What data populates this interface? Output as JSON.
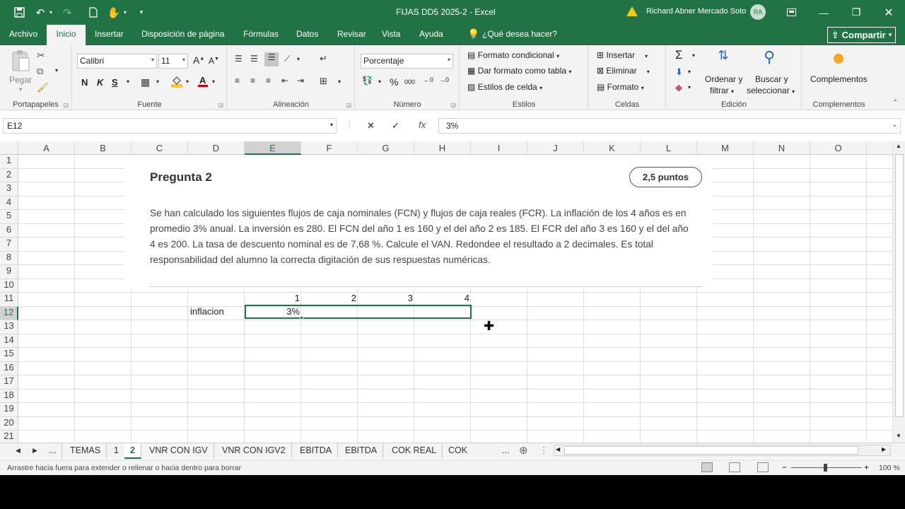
{
  "titlebar": {
    "title": "FIJAS DD5 2025-2  -  Excel",
    "user": "Richard Abner Mercado Soto",
    "avatar": "RA",
    "icons": [
      "save-icon",
      "undo-icon",
      "redo-icon",
      "new-file-icon",
      "touch-mode-icon",
      "customize-qat-icon",
      "warning-icon",
      "ribbon-display-icon",
      "minimize-icon",
      "restore-icon",
      "close-icon"
    ]
  },
  "tabs": [
    "Archivo",
    "Inicio",
    "Insertar",
    "Disposición de página",
    "Fórmulas",
    "Datos",
    "Revisar",
    "Vista",
    "Ayuda",
    "¿Qué desea hacer?"
  ],
  "share_label": "Compartir",
  "ribbon": {
    "clipboard": {
      "label": "Portapapeles",
      "paste": "Pegar"
    },
    "font": {
      "label": "Fuente",
      "font_name": "Calibri",
      "font_size": "11",
      "bold": "N",
      "italic": "K",
      "underline": "S"
    },
    "alignment": {
      "label": "Alineación"
    },
    "number": {
      "label": "Número",
      "format": "Porcentaje"
    },
    "styles": {
      "label": "Estilos",
      "conditional": "Formato condicional",
      "as_table": "Dar formato como tabla",
      "cell_styles": "Estilos de celda"
    },
    "cells": {
      "label": "Celdas",
      "insert": "Insertar",
      "delete": "Eliminar",
      "format": "Formato"
    },
    "editing": {
      "label": "Edición",
      "sort_1": "Ordenar y",
      "sort_2": "filtrar",
      "find_1": "Buscar y",
      "find_2": "seleccionar"
    },
    "addins": {
      "label": "Complementos",
      "button": "Complementos"
    }
  },
  "formula_bar": {
    "name_box": "E12",
    "formula": "3%"
  },
  "columns": [
    "A",
    "B",
    "C",
    "D",
    "E",
    "F",
    "G",
    "H",
    "I",
    "J",
    "K",
    "L",
    "M",
    "N",
    "O"
  ],
  "rows": [
    "1",
    "2",
    "3",
    "4",
    "5",
    "6",
    "7",
    "8",
    "9",
    "10",
    "11",
    "12",
    "13",
    "14",
    "15",
    "16",
    "17",
    "18",
    "19",
    "20",
    "21"
  ],
  "card": {
    "title": "Pregunta 2",
    "points": "2,5 puntos",
    "line1": "Se han calculado los siguientes flujos de caja nominales (FCN) y flujos de caja reales (FCR). La inflación de los 4 años es en",
    "line2": "promedio 3% anual. La inversión es 280. El FCN del año 1 es 160 y el del año 2 es 185. El FCR del año 3 es 160 y el del año",
    "line3": "4 es 200. La tasa de descuento nominal es de 7,68 %. Calcule el VAN. Redondee el resultado a 2 decimales. Es total",
    "line4": "responsabilidad del alumno la correcta digitación de sus respuestas numéricas."
  },
  "cells": {
    "E11": "1",
    "F11": "2",
    "G11": "3",
    "H11": "4",
    "D12": "inflacion",
    "E12": "3%"
  },
  "sheets": [
    "...",
    "TEMAS",
    "1",
    "2",
    "VNR CON IGV",
    "VNR CON IGV2",
    "EBITDA",
    "EBITDA",
    "COK REAL",
    "COK NOMI"
  ],
  "sheets_more": "...",
  "status": {
    "message": "Arrastre hacia fuera para extender o rellenar o hacia dentro para borrar",
    "zoom": "100 %"
  },
  "colors": {
    "excel_green": "#217346",
    "ribbon_bg": "#f3f3f3"
  }
}
